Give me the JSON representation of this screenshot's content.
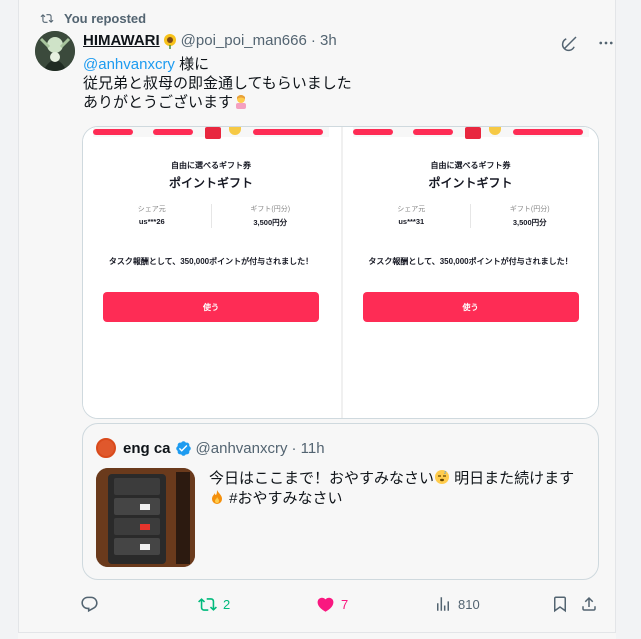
{
  "repost": {
    "label": "You reposted"
  },
  "tweet": {
    "display_name": "HIMAWARI",
    "handle": "@poi_poi_man666",
    "time": "· 3h",
    "mention": "@anhvanxcry",
    "line1_rest": " 様に",
    "line2": "従兄弟と叔母の即金通してもらいました",
    "line3": "ありがとうございます"
  },
  "media": {
    "cards": [
      {
        "title": "自由に選べるギフト券",
        "heading": "ポイントギフト",
        "share_label": "シェア元",
        "share_value": "us***26",
        "gift_label": "ギフト(円分)",
        "gift_value": "3,500円分",
        "message": "タスク報酬として、350,000ポイントが付与されました！",
        "button": "使う"
      },
      {
        "title": "自由に選べるギフト券",
        "heading": "ポイントギフト",
        "share_label": "シェア元",
        "share_value": "us***31",
        "gift_label": "ギフト(円分)",
        "gift_value": "3,500円分",
        "message": "タスク報酬として、350,000ポイントが付与されました！",
        "button": "使う"
      }
    ]
  },
  "quote": {
    "display_name": "eng ca",
    "handle": "@anhvanxcry",
    "time": "· 11h",
    "text_a": "今日はここまで！おやすみなさい",
    "text_b": " 明日また続けます",
    "text_c": " #おやすみなさい"
  },
  "actions": {
    "reposts": "2",
    "likes": "7",
    "views": "810"
  },
  "colors": {
    "accent": "#1d9bf0",
    "repost_active": "#00ba7c",
    "like_active": "#f91880",
    "gift_red": "#fe2c55"
  },
  "icons": {
    "repost": "repost-icon",
    "grok": "grok-icon",
    "more": "more-icon",
    "reply": "reply-icon",
    "like": "heart-icon",
    "views": "views-icon",
    "bookmark": "bookmark-icon",
    "share": "share-icon"
  }
}
